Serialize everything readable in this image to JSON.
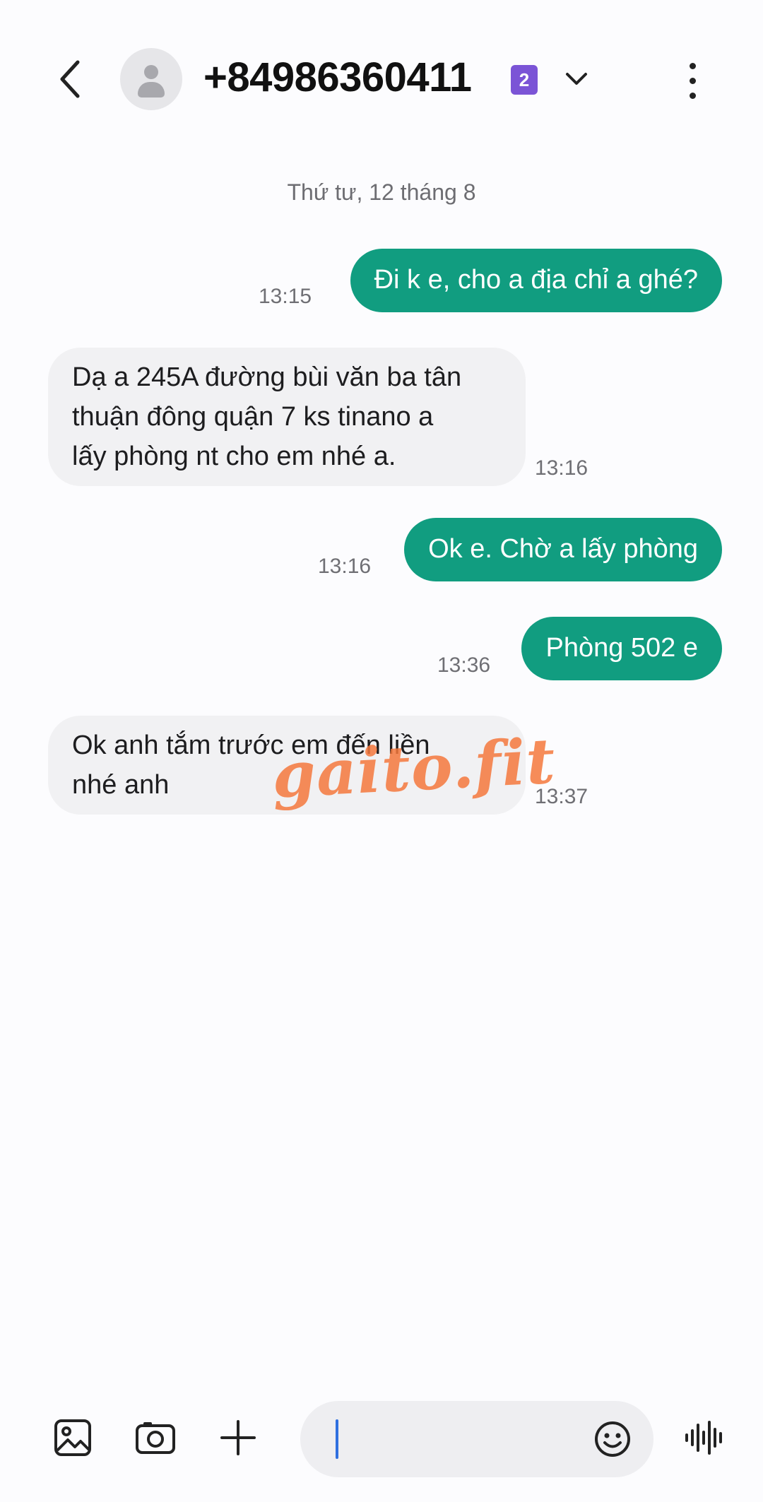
{
  "header": {
    "contact_name": "+84986360411",
    "sim_badge": "2"
  },
  "conversation": {
    "date": "Thứ tư, 12 tháng 8",
    "messages": [
      {
        "direction": "sent",
        "text": "Đi k e, cho a địa chỉ a ghé?",
        "time": "13:15"
      },
      {
        "direction": "received",
        "lines": [
          "Dạ a 245A đường bùi văn ba tân",
          "thuận đông  quận 7 ks tinano  a",
          "lấy phòng nt cho em nhé a."
        ],
        "time": "13:16"
      },
      {
        "direction": "sent",
        "text": "Ok e. Chờ a lấy phòng",
        "time": "13:16"
      },
      {
        "direction": "sent",
        "text": "Phòng 502 e",
        "time": "13:36"
      },
      {
        "direction": "received",
        "lines": [
          "Ok anh tắm trước em đến liền",
          "nhé anh"
        ],
        "time": "13:37"
      }
    ]
  },
  "watermark": "gaito.fit",
  "composer": {
    "icons": [
      "gallery-icon",
      "camera-icon",
      "plus-icon",
      "emoji-icon",
      "voice-icon"
    ]
  },
  "colors": {
    "sent_bubble": "#119d80",
    "received_bubble": "#f1f1f3",
    "sim_badge": "#7b54d6",
    "watermark": "#f4783c"
  }
}
